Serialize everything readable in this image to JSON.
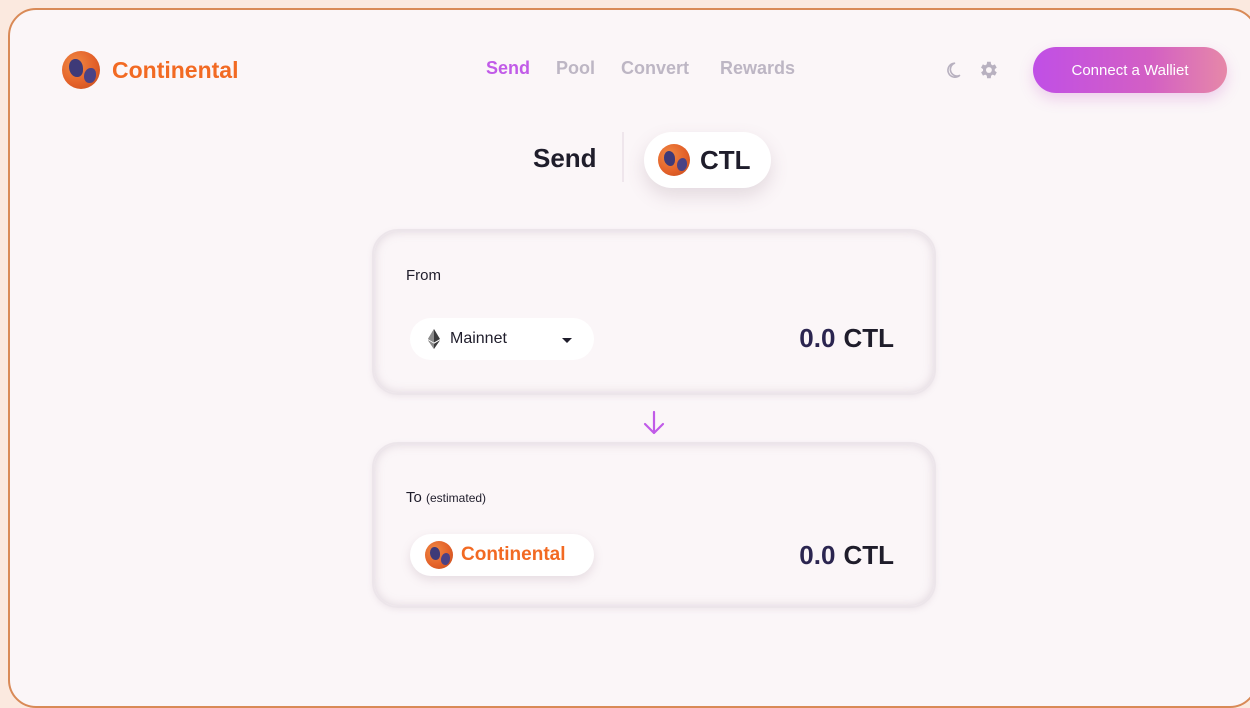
{
  "app": {
    "brand_name": "Continental"
  },
  "nav": {
    "items": [
      {
        "label": "Send",
        "active": true
      },
      {
        "label": "Pool",
        "active": false
      },
      {
        "label": "Convert",
        "active": false
      },
      {
        "label": "Rewards",
        "active": false
      }
    ]
  },
  "header": {
    "icons": [
      "moon-icon",
      "gear-icon"
    ],
    "connect_label": "Connect a Walliet"
  },
  "title": {
    "label": "Send",
    "token": "CTL"
  },
  "from_card": {
    "label": "From",
    "network": "Mainnet",
    "network_icon": "ethereum-icon",
    "amount": "0.0",
    "unit": "CTL"
  },
  "to_card": {
    "label": "To",
    "label_note": "(estimated)",
    "token_name": "Continental",
    "amount": "0.0",
    "unit": "CTL"
  },
  "colors": {
    "accent": "#c15be8",
    "brand": "#f26a23",
    "text": "#1f1d2b",
    "muted": "#bdb6c4"
  }
}
